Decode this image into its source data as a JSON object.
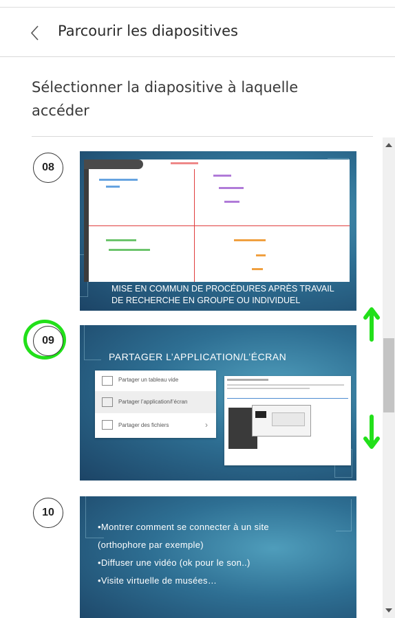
{
  "header": {
    "back_icon": "chevron-left-icon",
    "title": "Parcourir les diapositives"
  },
  "subtitle": "Sélectionner la diapositive à laquelle accéder",
  "slides": [
    {
      "number": "08",
      "caption_line1": "MISE EN COMMUN DE PROCÉDURES APRÈS TRAVAIL",
      "caption_line2": "DE RECHERCHE EN GROUPE OU INDIVIDUEL"
    },
    {
      "number": "09",
      "title": "PARTAGER L’APPLICATION/L’ÉCRAN",
      "menu": [
        "Partager un tableau vide",
        "Partager l’application/l’écran",
        "Partager des fichiers"
      ]
    },
    {
      "number": "10",
      "bullets": [
        "•Montrer comment se connecter à un site",
        "(orthophore par exemple)",
        "•Diffuser une vidéo (ok pour le son..)",
        "•Visite virtuelle de musées…"
      ]
    }
  ],
  "annotations": {
    "highlight_color": "#22e01a"
  }
}
